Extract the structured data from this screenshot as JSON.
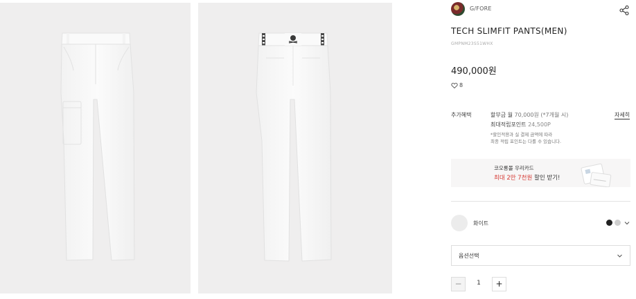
{
  "gallery": {
    "front_image_alt": "front-view-pants",
    "back_image_alt": "back-view-pants"
  },
  "brand": {
    "name": "G/FORE",
    "icon": "brand-avatar"
  },
  "product": {
    "title": "TECH SLIMFIT PANTS(MEN)",
    "code": "GMPNM23S51WHX",
    "price": "490,000원",
    "wish_count": "8"
  },
  "benefits": {
    "label": "추가혜택",
    "installment_prefix": "할부금 월 ",
    "installment_amount": "70,000원 (*7개월 시)",
    "points_label": "최대적립포인트 ",
    "points_value": "24,500P",
    "note_line1": "*할인적용과 실 결제 금액에 따라",
    "note_line2": "최종 적립 포인트는 다를 수 있습니다.",
    "detail_link": "자세히"
  },
  "card_banner": {
    "title": "코오롱몰 우리카드",
    "text_red": "최대 2만 7천원",
    "text_normal": " 할인 받기!"
  },
  "color": {
    "selected_name": "화이트",
    "swatches": [
      "#222222",
      "#cfcfcf"
    ]
  },
  "option_select": {
    "placeholder": "옵션선택"
  },
  "quantity": {
    "minus": "−",
    "value": "1",
    "plus": "+"
  }
}
